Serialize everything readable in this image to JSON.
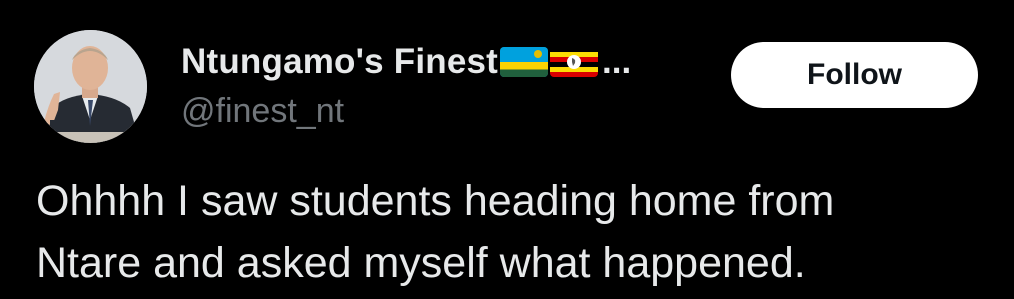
{
  "author": {
    "display_name": "Ntungamo's Finest",
    "flags": [
      "rwanda-flag-icon",
      "uganda-flag-icon"
    ],
    "truncation": "...",
    "handle": "@finest_nt"
  },
  "actions": {
    "follow_label": "Follow"
  },
  "tweet": {
    "lines": [
      "Ohhhh I saw students heading home from",
      "Ntare and asked myself what happened."
    ]
  },
  "colors": {
    "background": "#000000",
    "primary_text": "#e7e9ea",
    "secondary_text": "#71767b",
    "follow_bg": "#ffffff",
    "follow_text": "#0f1419"
  }
}
